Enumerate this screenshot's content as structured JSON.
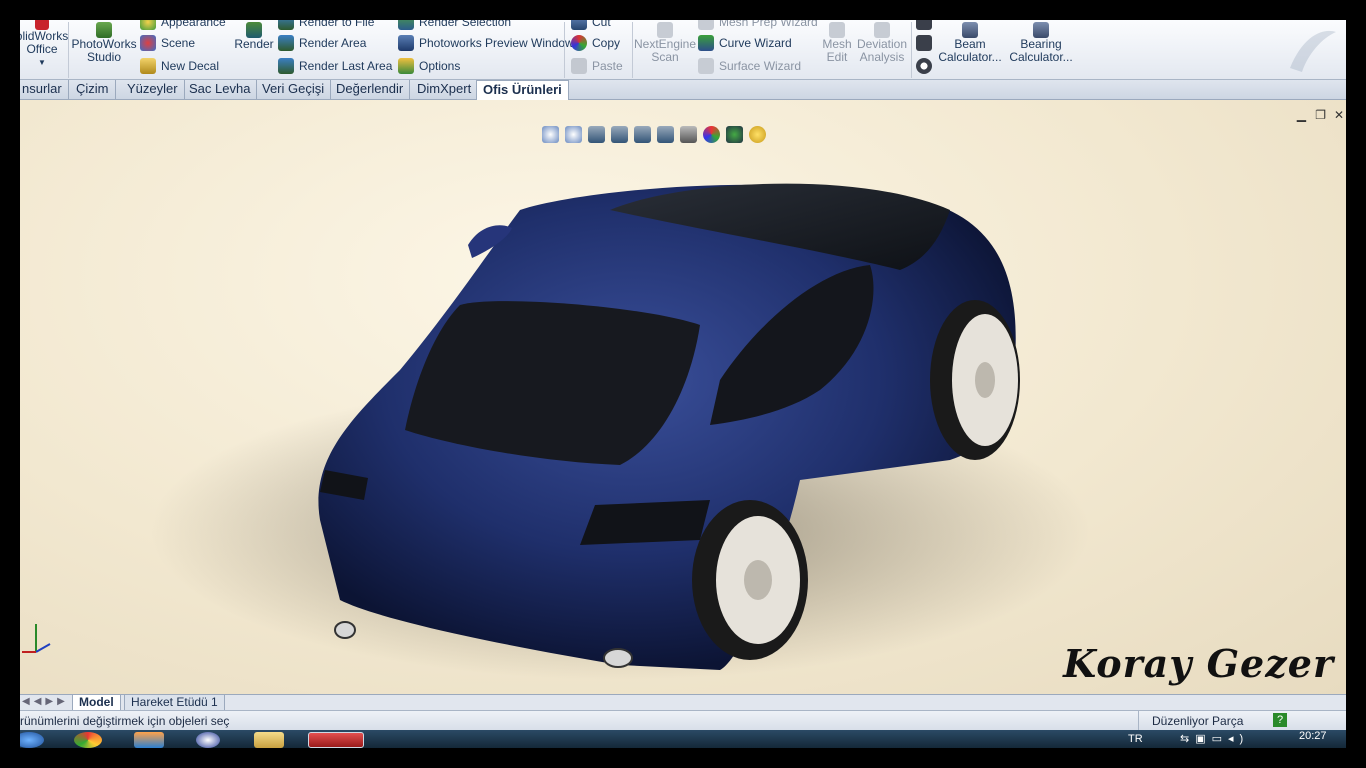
{
  "ribbon": {
    "solidworks_office": "olidWorks\nOffice",
    "photoworks_studio": "PhotoWorks\nStudio",
    "appearance": "Appearance",
    "scene": "Scene",
    "new_decal": "New Decal",
    "render": "Render",
    "render_to_file": "Render to File",
    "render_area": "Render Area",
    "render_last_area": "Render Last Area",
    "render_selection": "Render Selection",
    "photoworks_preview_window": "Photoworks Preview Window",
    "options": "Options",
    "cut": "Cut",
    "copy": "Copy",
    "paste": "Paste",
    "nextengine_scan": "NextEngine\nScan",
    "mesh_prep_wizard": "Mesh Prep Wizard",
    "curve_wizard": "Curve Wizard",
    "surface_wizard": "Surface Wizard",
    "mesh_edit": "Mesh\nEdit",
    "deviation_analysis": "Deviation\nAnalysis",
    "beam_calculator": "Beam\nCalculator...",
    "bearing_calculator": "Bearing\nCalculator..."
  },
  "tabs": [
    "nsurlar",
    "Çizim",
    "Yüzeyler",
    "Sac Levha",
    "Veri Geçişi",
    "Değerlendir",
    "DimXpert",
    "Ofis Ürünleri"
  ],
  "active_tab": "Ofis Ürünleri",
  "viewport": {
    "signature": "Koray Gezer"
  },
  "bottom_tabs": {
    "model": "Model",
    "motion_study": "Hareket Etüdü 1"
  },
  "status": {
    "message": "rünümlerini değiştirmek için objeleri seç",
    "mode": "Düzenliyor Parça",
    "help": "?"
  },
  "taskbar": {
    "language": "TR",
    "time": "20:27"
  },
  "colors": {
    "car_body": "#1f2f6b",
    "background": "#f4ead3"
  }
}
